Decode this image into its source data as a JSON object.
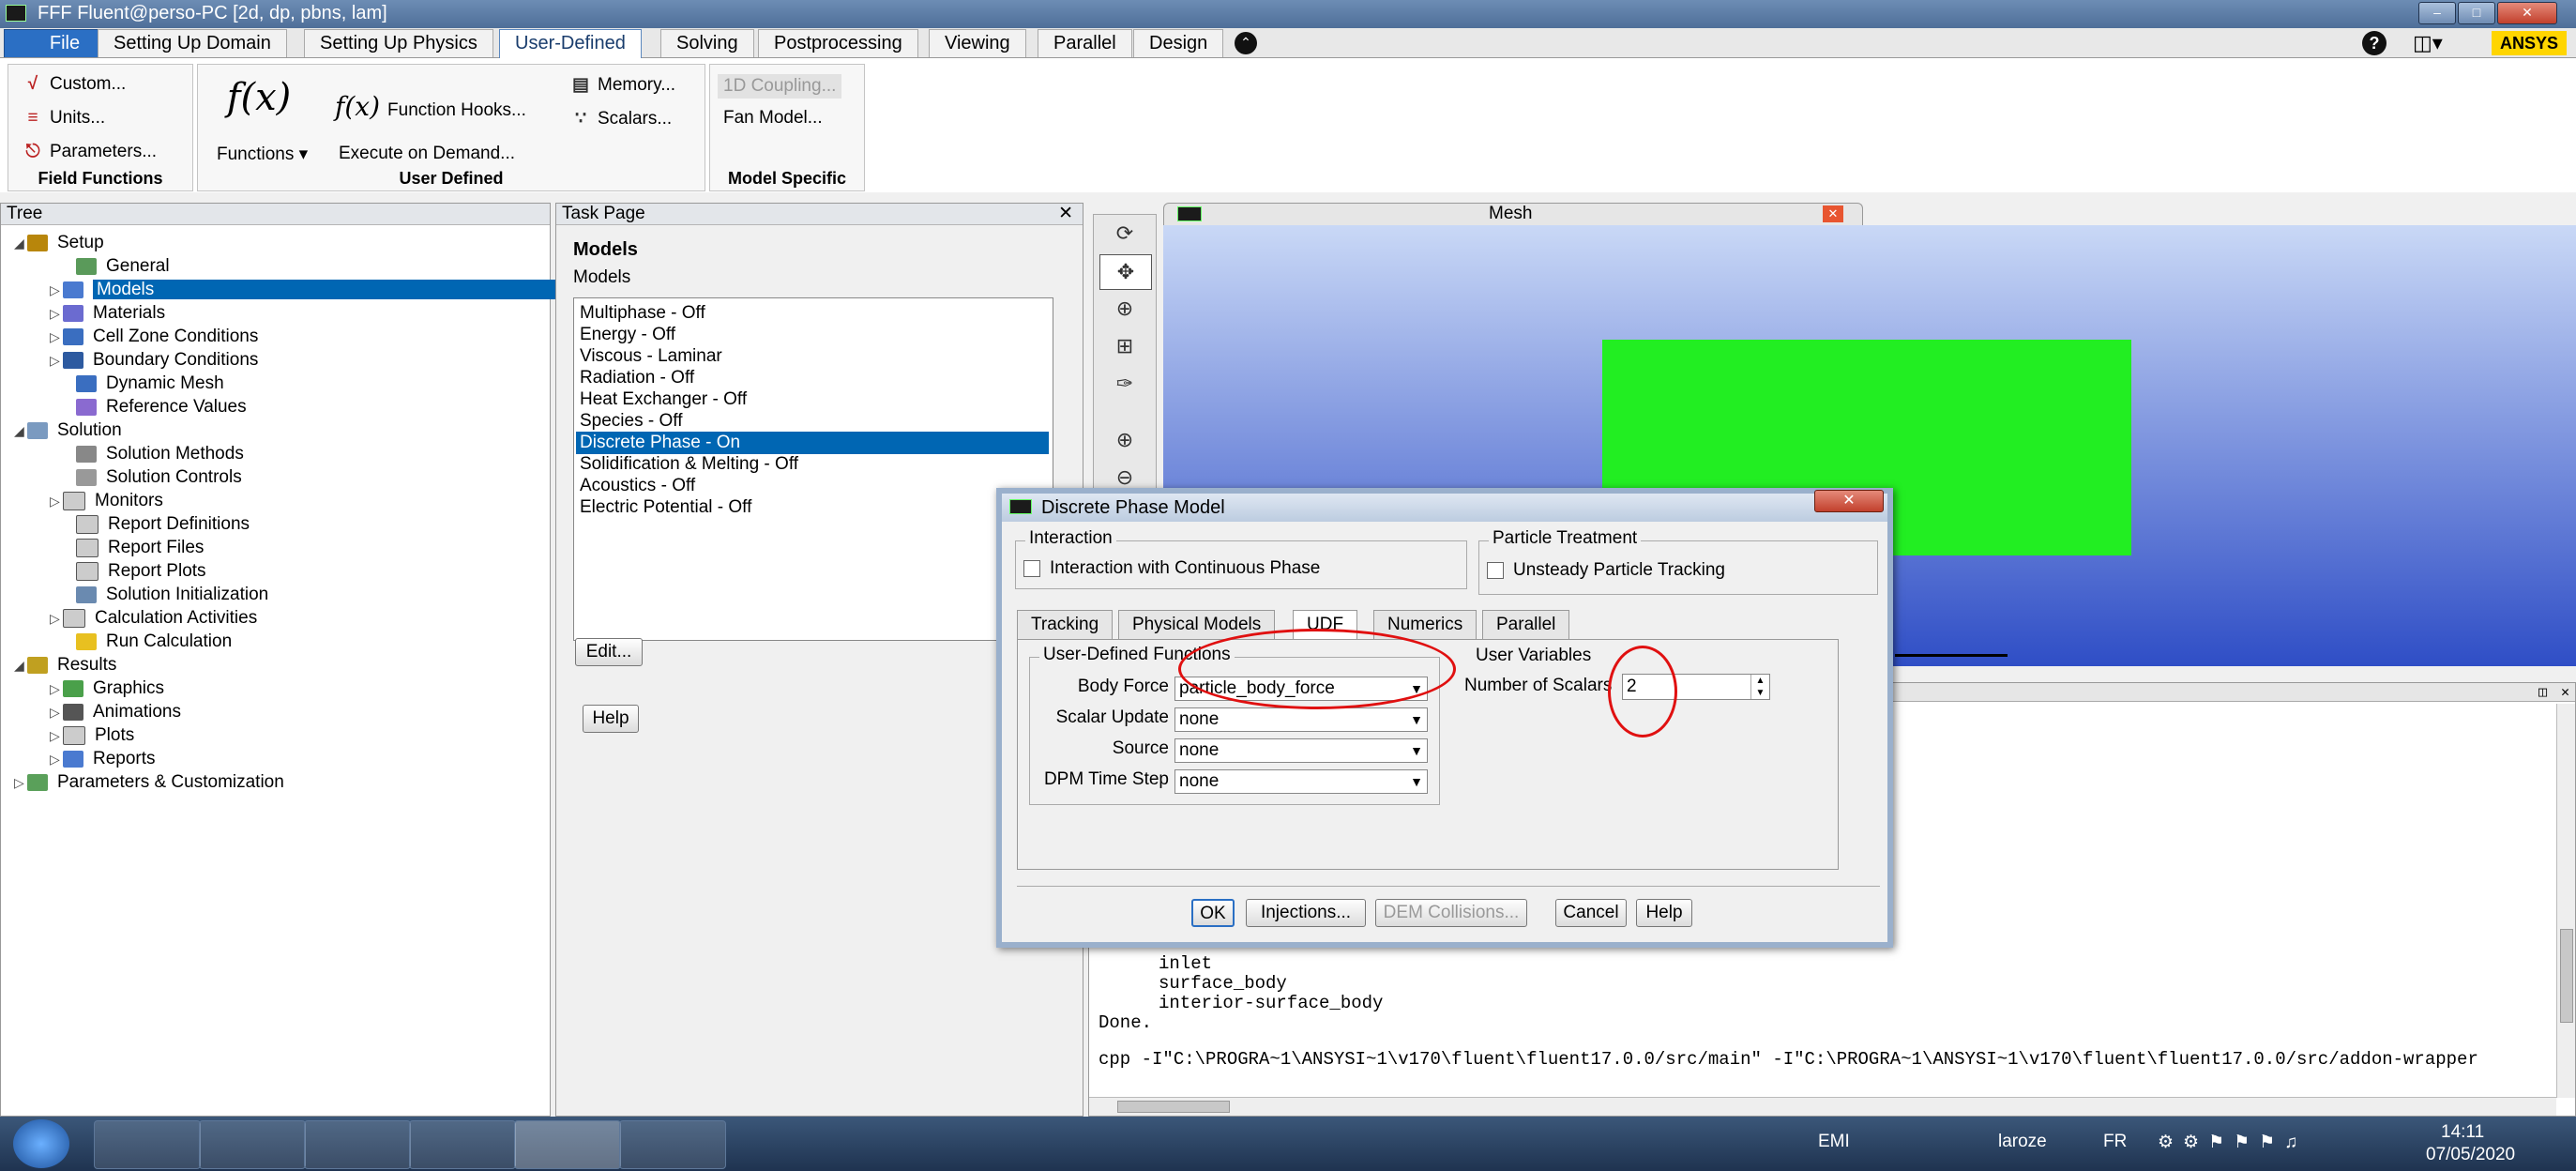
{
  "window": {
    "title": "FFF Fluent@perso-PC  [2d, dp, pbns, lam]"
  },
  "menu": {
    "tabs": [
      "File",
      "Setting Up Domain",
      "Setting Up Physics",
      "User-Defined",
      "Solving",
      "Postprocessing",
      "Viewing",
      "Parallel",
      "Design"
    ],
    "brand": "ANSYS"
  },
  "ribbon": {
    "field_functions": {
      "label": "Field Functions",
      "custom": "Custom...",
      "units": "Units...",
      "parameters": "Parameters..."
    },
    "user_defined": {
      "label": "User Defined",
      "functions": "Functions",
      "function_hooks": "Function Hooks...",
      "execute_on_demand": "Execute on Demand...",
      "memory": "Memory...",
      "scalars": "Scalars..."
    },
    "model_specific": {
      "label": "Model Specific",
      "coupling": "1D Coupling...",
      "fan_model": "Fan Model..."
    }
  },
  "tree": {
    "header": "Tree",
    "items": [
      "Setup",
      "General",
      "Models",
      "Materials",
      "Cell Zone Conditions",
      "Boundary Conditions",
      "Dynamic Mesh",
      "Reference Values",
      "Solution",
      "Solution Methods",
      "Solution Controls",
      "Monitors",
      "Report Definitions",
      "Report Files",
      "Report Plots",
      "Solution Initialization",
      "Calculation Activities",
      "Run Calculation",
      "Results",
      "Graphics",
      "Animations",
      "Plots",
      "Reports",
      "Parameters & Customization"
    ]
  },
  "task": {
    "header": "Task Page",
    "title": "Models",
    "subtitle": "Models",
    "models": [
      "Multiphase - Off",
      "Energy - Off",
      "Viscous - Laminar",
      "Radiation - Off",
      "Heat Exchanger - Off",
      "Species - Off",
      "Discrete Phase - On",
      "Solidification & Melting - Off",
      "Acoustics - Off",
      "Electric Potential - Off"
    ],
    "edit": "Edit...",
    "help": "Help"
  },
  "graphics": {
    "tab": "Mesh"
  },
  "console": {
    "lines": [
      "inlet",
      "surface_body",
      "interior-surface_body",
      "Done.",
      "cpp -I\"C:\\PROGRA~1\\ANSYSI~1\\v170\\fluent\\fluent17.0.0/src/main\" -I\"C:\\PROGRA~1\\ANSYSI~1\\v170\\fluent\\fluent17.0.0/src/addon-wrapper"
    ]
  },
  "dialog": {
    "title": "Discrete Phase Model",
    "interaction": {
      "label": "Interaction",
      "checkbox": "Interaction with Continuous Phase"
    },
    "particle_treatment": {
      "label": "Particle Treatment",
      "checkbox": "Unsteady Particle Tracking"
    },
    "tabs": [
      "Tracking",
      "Physical Models",
      "UDF",
      "Numerics",
      "Parallel"
    ],
    "udf": {
      "label": "User-Defined Functions",
      "body_force_label": "Body Force",
      "body_force_value": "particle_body_force",
      "scalar_update_label": "Scalar Update",
      "scalar_update_value": "none",
      "source_label": "Source",
      "source_value": "none",
      "dpm_time_step_label": "DPM Time Step",
      "dpm_time_step_value": "none"
    },
    "user_variables": {
      "label": "User Variables",
      "num_scalars_label": "Number of Scalars",
      "num_scalars_value": "2"
    },
    "buttons": {
      "ok": "OK",
      "injections": "Injections...",
      "dem": "DEM Collisions...",
      "cancel": "Cancel",
      "help": "Help"
    }
  },
  "taskbar": {
    "lang": "EMI",
    "user": "laroze",
    "locale": "FR",
    "time": "14:11",
    "date": "07/05/2020"
  }
}
